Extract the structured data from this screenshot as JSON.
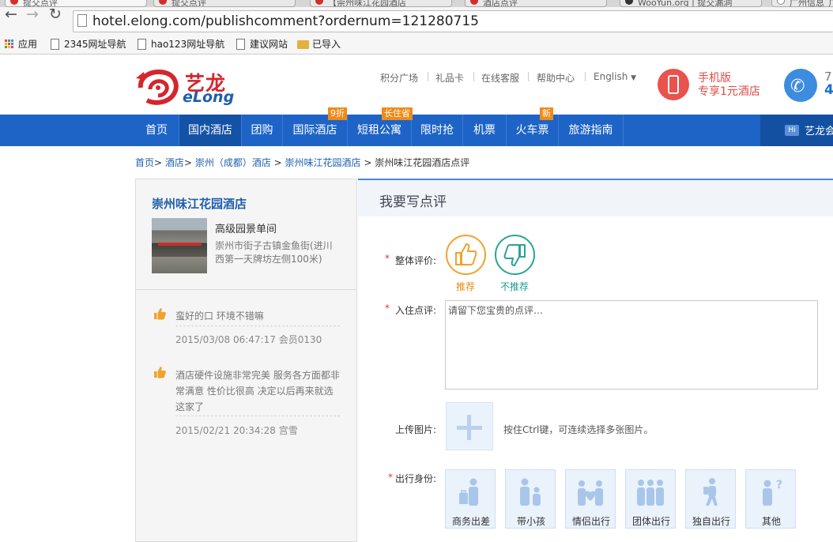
{
  "browser": {
    "tabs": [
      "提交点评",
      "提交点评",
      "【崇州味江花园酒店",
      "酒店点评",
      "WooYun.org | 提交漏洞",
      "广州信息_广"
    ],
    "url": "hotel.elong.com/publishcomment?ordernum=121280715",
    "bookmarks": [
      {
        "label": "应用",
        "icon": "apps-icon"
      },
      {
        "label": "2345网址导航",
        "icon": "page-icon"
      },
      {
        "label": "hao123网址导航",
        "icon": "page-icon"
      },
      {
        "label": "建议网站",
        "icon": "page-icon"
      },
      {
        "label": "已导入",
        "icon": "folder-icon"
      }
    ]
  },
  "brand": {
    "name_cn": "艺龙",
    "name_en": "eLong",
    "red": "#d4262d",
    "blue": "#1d64c6"
  },
  "top_links": [
    "积分广场",
    "礼品卡",
    "在线客服",
    "帮助中心",
    "English"
  ],
  "mobile_promo": {
    "line1": "手机版",
    "line2": "专享1元酒店"
  },
  "hotline": {
    "line1": "7",
    "line2": "4"
  },
  "nav": {
    "items": [
      {
        "label": "首页",
        "badge": ""
      },
      {
        "label": "国内酒店",
        "badge": ""
      },
      {
        "label": "团购",
        "badge": ""
      },
      {
        "label": "国际酒店",
        "badge": "9折"
      },
      {
        "label": "短租公寓",
        "badge": "长住省"
      },
      {
        "label": "限时抢",
        "badge": ""
      },
      {
        "label": "机票",
        "badge": ""
      },
      {
        "label": "火车票",
        "badge": "新"
      },
      {
        "label": "旅游指南",
        "badge": ""
      }
    ],
    "member_badge": "Hi",
    "member_text": "艺龙会"
  },
  "breadcrumb": [
    {
      "label": "首页",
      "sep": ">"
    },
    {
      "label": "酒店",
      "sep": ">"
    },
    {
      "label": "崇州（成都）酒店",
      "sep": ">"
    },
    {
      "label": "崇州味江花园酒店",
      "sep": ">"
    },
    {
      "label": "崇州味江花园酒店点评",
      "sep": ""
    }
  ],
  "hotel": {
    "name": "崇州味江花园酒店",
    "room": "高级园景单间",
    "address_line1": "崇州市街子古镇金鱼街(进川",
    "address_line2": "西第一天牌坊左侧100米)"
  },
  "reviews": [
    {
      "text_lines": [
        "蛮好的口 环境不错嘛"
      ],
      "meta": "2015/03/08 06:47:17 会员0130"
    },
    {
      "text_lines": [
        "酒店硬件设施非常完美 服务各方面都非",
        "常满意 性价比很高 决定以后再来就选",
        "这家了"
      ],
      "meta": "2015/02/21 20:34:28 宫雪"
    }
  ],
  "form": {
    "title": "我要写点评",
    "required_mark": "*",
    "overall_label": "整体评价:",
    "recommend": "推荐",
    "not_recommend": "不推荐",
    "comment_label": "入住点评:",
    "comment_placeholder": "请留下您宝贵的点评…",
    "upload_label": "上传图片:",
    "upload_hint": "按住Ctrl键，可连续选择多张图片。",
    "identity_label": "出行身份:",
    "identities": [
      "商务出差",
      "带小孩",
      "情侣出行",
      "团体出行",
      "独自出行",
      "其他"
    ]
  }
}
